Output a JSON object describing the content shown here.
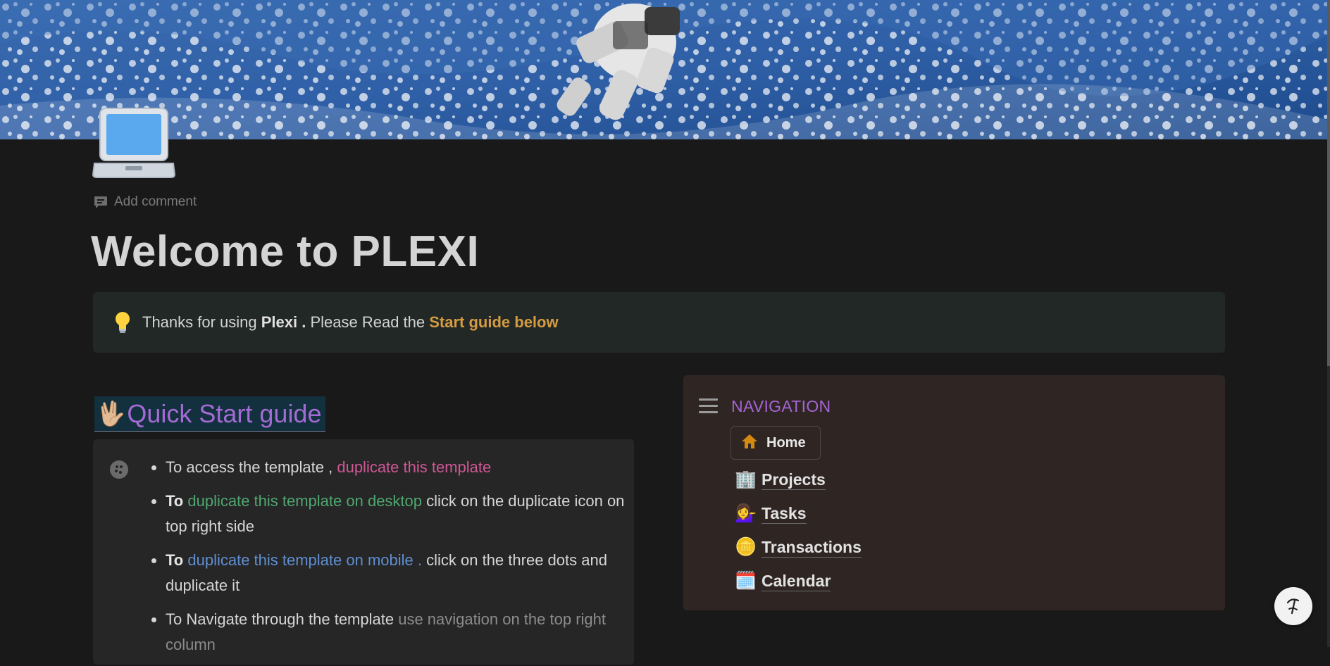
{
  "page": {
    "icon": "laptop-icon",
    "add_comment": "Add comment",
    "title": "Welcome to PLEXI"
  },
  "callout": {
    "icon": "lightbulb-icon",
    "text_1": "Thanks for using ",
    "text_bold": "Plexi .",
    "text_2": " Please Read the ",
    "text_highlight": "Start guide below"
  },
  "quick_start": {
    "heading_emoji": "🖖🏼",
    "heading": "Quick Start guide",
    "items": [
      {
        "a": "To access the template , ",
        "link": "duplicate this template",
        "b": ""
      },
      {
        "lead": "To ",
        "link": "duplicate this template on desktop",
        "b": " click on the duplicate icon on top right side"
      },
      {
        "lead": "To ",
        "link": "duplicate this template on mobile .",
        "b": "  click on the three dots and duplicate it"
      },
      {
        "a": "To Navigate through the template ",
        "link": "use navigation on the top right column",
        "b": ""
      }
    ]
  },
  "navigation": {
    "title": "NAVIGATION",
    "home": {
      "emoji": "🏠",
      "label": "Home"
    },
    "items": [
      {
        "emoji": "🏢",
        "label": "Projects"
      },
      {
        "emoji": "💁‍♀️",
        "label": "Tasks"
      },
      {
        "emoji": "🪙",
        "label": "Transactions"
      },
      {
        "emoji": "🗓️",
        "label": "Calendar"
      }
    ]
  },
  "colors": {
    "background": "#191919",
    "nav_title": "#a664d6",
    "heading": "#a36bd3",
    "highlight_orange": "#d49b42",
    "pink": "#d15796",
    "green": "#4fa671",
    "blue": "#5f8fd1"
  }
}
